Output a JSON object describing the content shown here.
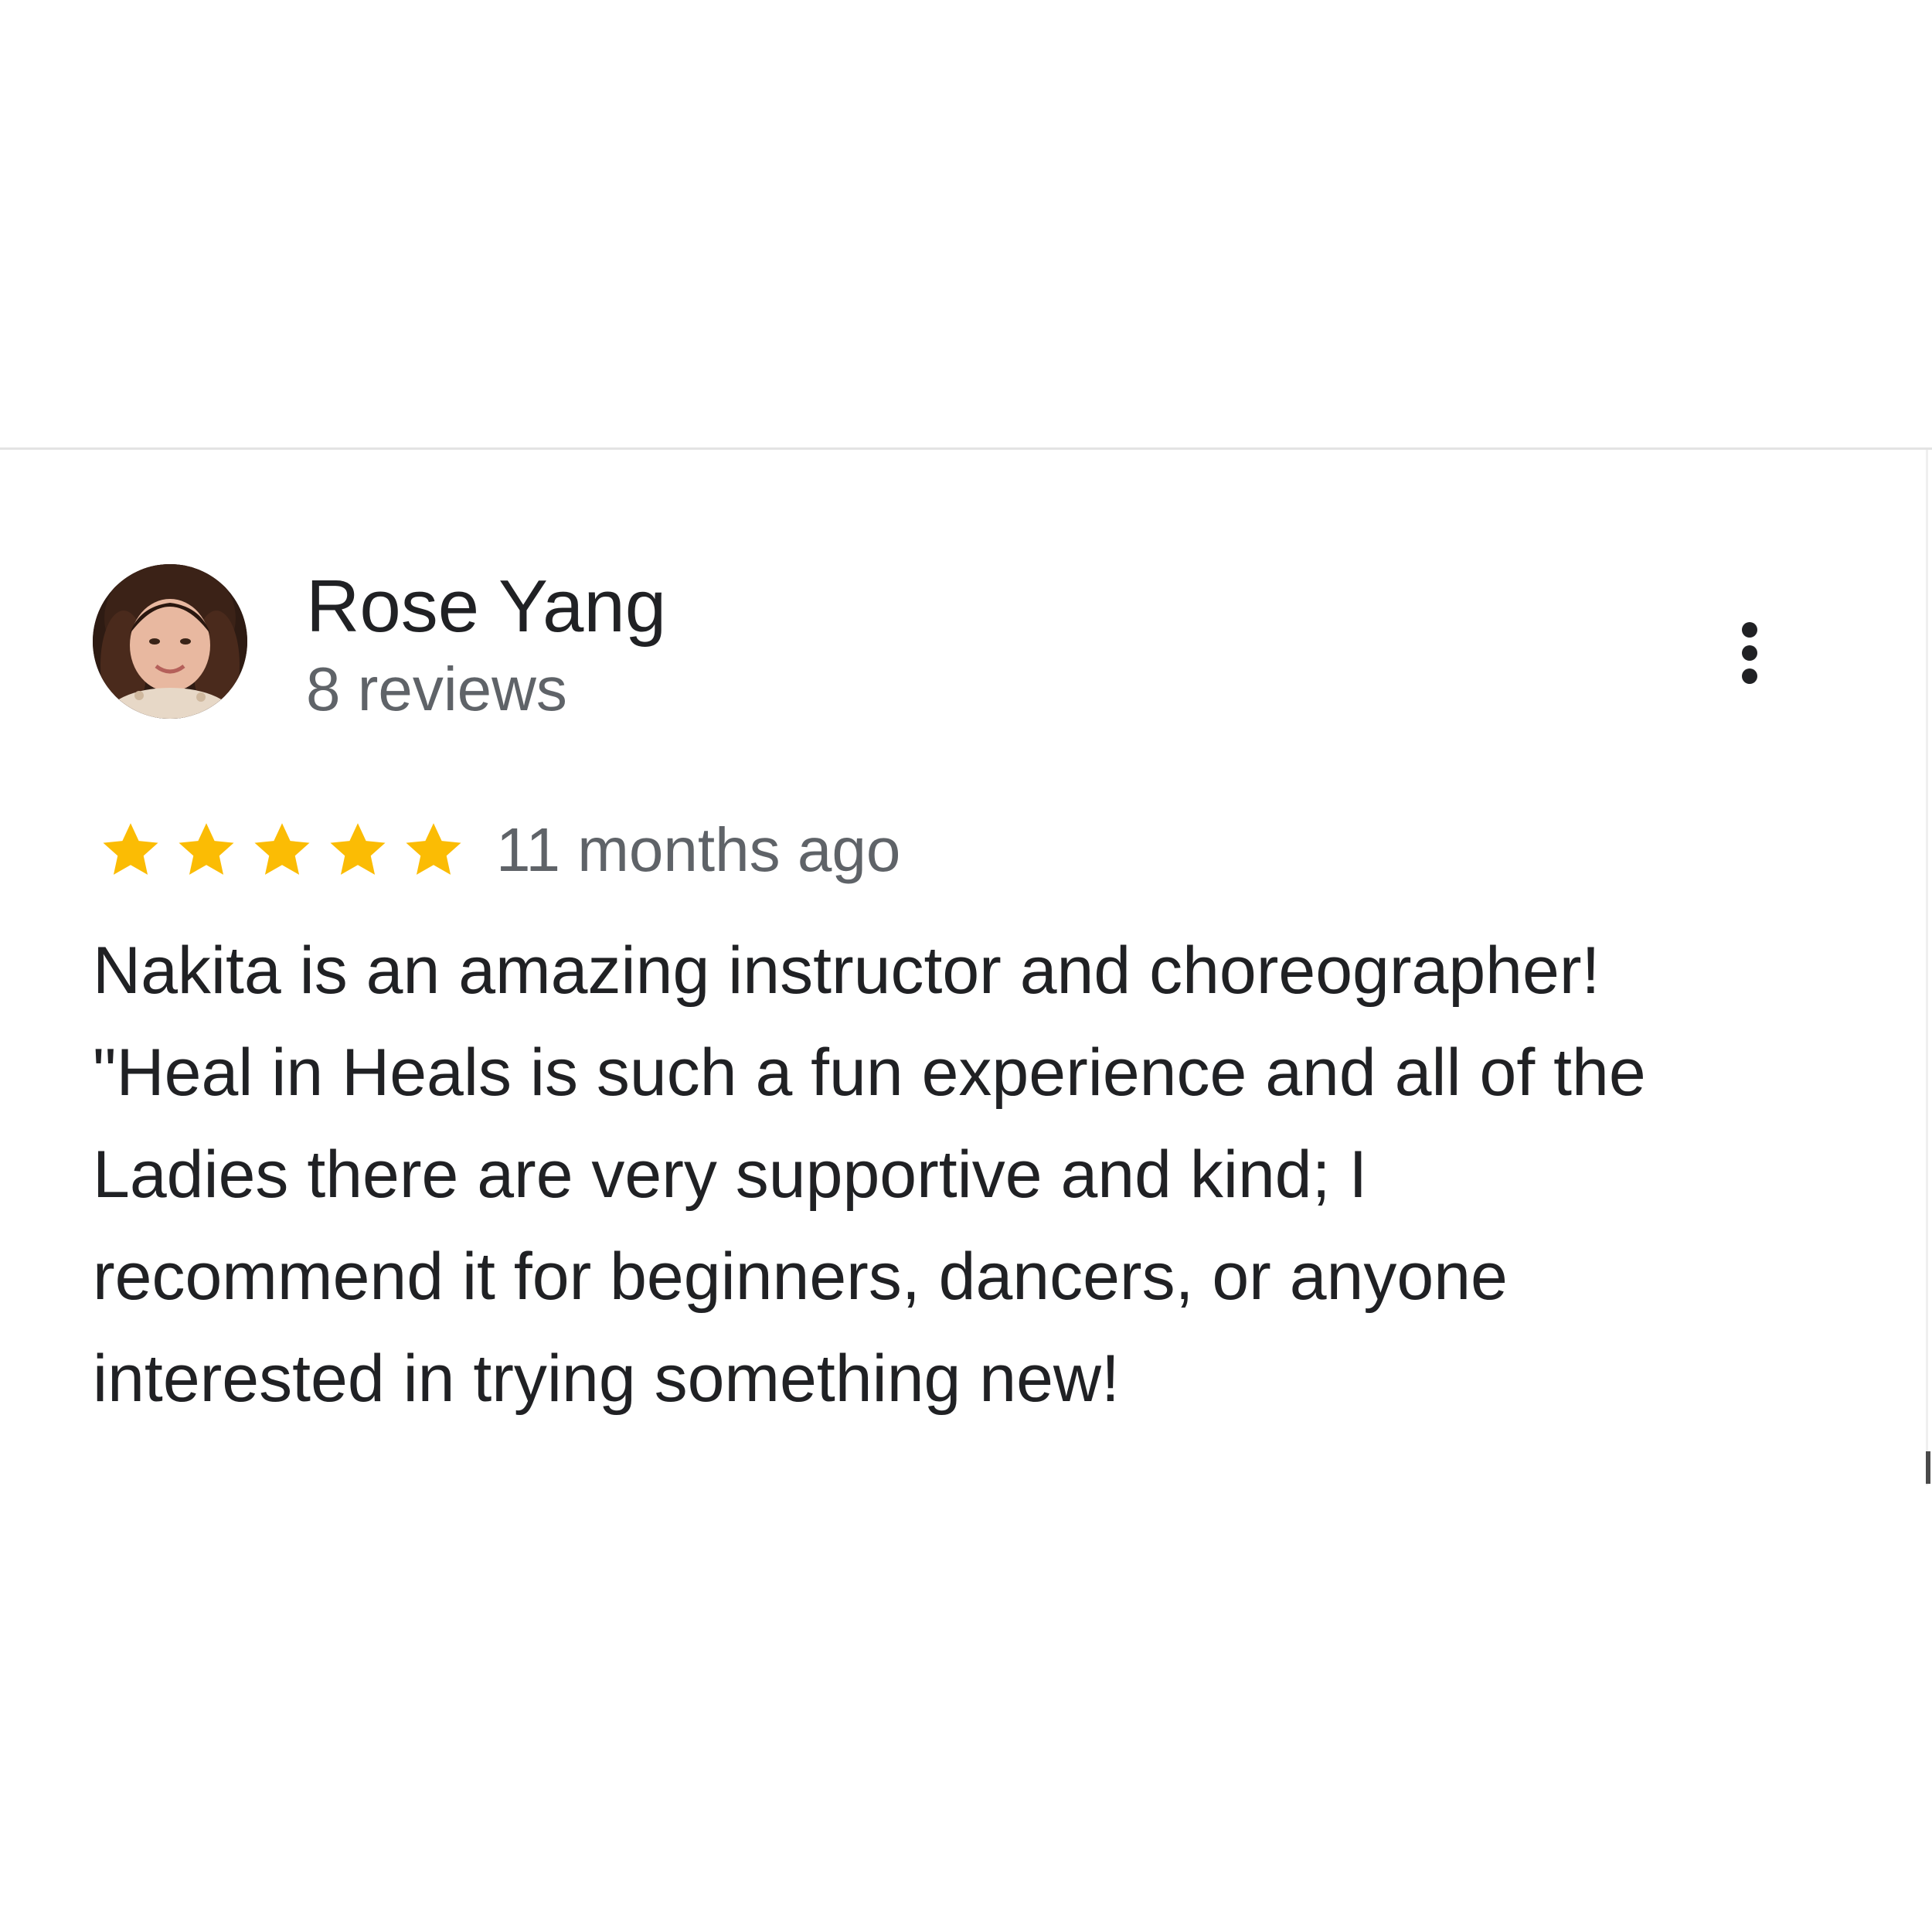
{
  "review": {
    "author_name": "Rose Yang",
    "author_meta": "8 reviews",
    "rating": 5,
    "rating_max": 5,
    "date": "11 months ago",
    "text_lines": [
      "Nakita is an amazing instructor and choreographer!",
      "\"Heal in Heals is such a fun experience and all of the",
      "Ladies there are very supportive and kind; I",
      "recommend it for beginners, dancers, or anyone",
      "interested in trying something new!"
    ]
  },
  "icons": {
    "avatar": "avatar-photo",
    "star": "star-icon",
    "more": "more-vert-icon"
  },
  "colors": {
    "star": "#fbbc04",
    "primary_text": "#202124",
    "secondary_text": "#5f6368",
    "divider": "#e3e3e3"
  }
}
